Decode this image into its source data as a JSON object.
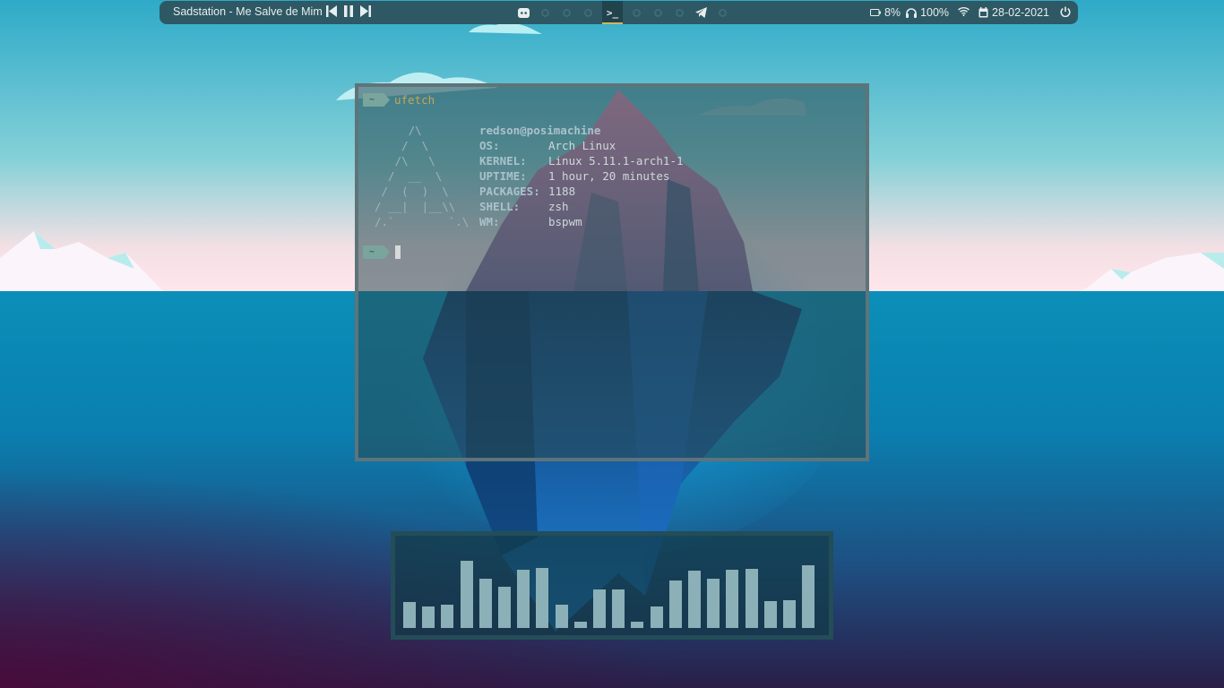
{
  "topbar": {
    "now_playing": "Sadstation - Me Salve de Mim",
    "media_controls": [
      "previous-icon",
      "pause-icon",
      "next-icon"
    ],
    "workspaces": [
      {
        "icon": "discord-icon",
        "active": false
      },
      {
        "icon": "empty-dot",
        "active": false
      },
      {
        "icon": "empty-dot",
        "active": false
      },
      {
        "icon": "empty-dot",
        "active": false
      },
      {
        "icon": "terminal-icon",
        "label": ">_",
        "active": true
      },
      {
        "icon": "empty-dot",
        "active": false
      },
      {
        "icon": "empty-dot",
        "active": false
      },
      {
        "icon": "empty-dot",
        "active": false
      },
      {
        "icon": "telegram-icon",
        "active": false
      },
      {
        "icon": "empty-dot",
        "active": false
      }
    ],
    "battery": "8%",
    "volume": "100%",
    "date": "28-02-2021",
    "accent_color": "#d6b35a"
  },
  "terminal": {
    "prompt_symbol": "~",
    "command": "ufetch",
    "ascii_art": "     /\\\n    /  \\\n   /\\   \\\n  /  __  \\\n /  (  )  \\\n/ __|  |__\\\\\n/.`        `.\\",
    "user_host": "redson@posimachine",
    "info": [
      {
        "key": "OS:",
        "value": "Arch Linux"
      },
      {
        "key": "KERNEL:",
        "value": "Linux 5.11.1-arch1-1"
      },
      {
        "key": "UPTIME:",
        "value": "1 hour, 20 minutes"
      },
      {
        "key": "PACKAGES:",
        "value": "1188"
      },
      {
        "key": "SHELL:",
        "value": "zsh"
      },
      {
        "key": "WM:",
        "value": "bspwm"
      }
    ]
  },
  "visualizer": {
    "levels": [
      0.38,
      0.31,
      0.34,
      0.99,
      0.72,
      0.61,
      0.86,
      0.88,
      0.34,
      0.09,
      0.57,
      0.57,
      0.09,
      0.31,
      0.7,
      0.84,
      0.72,
      0.86,
      0.87,
      0.4,
      0.41,
      0.92
    ]
  }
}
